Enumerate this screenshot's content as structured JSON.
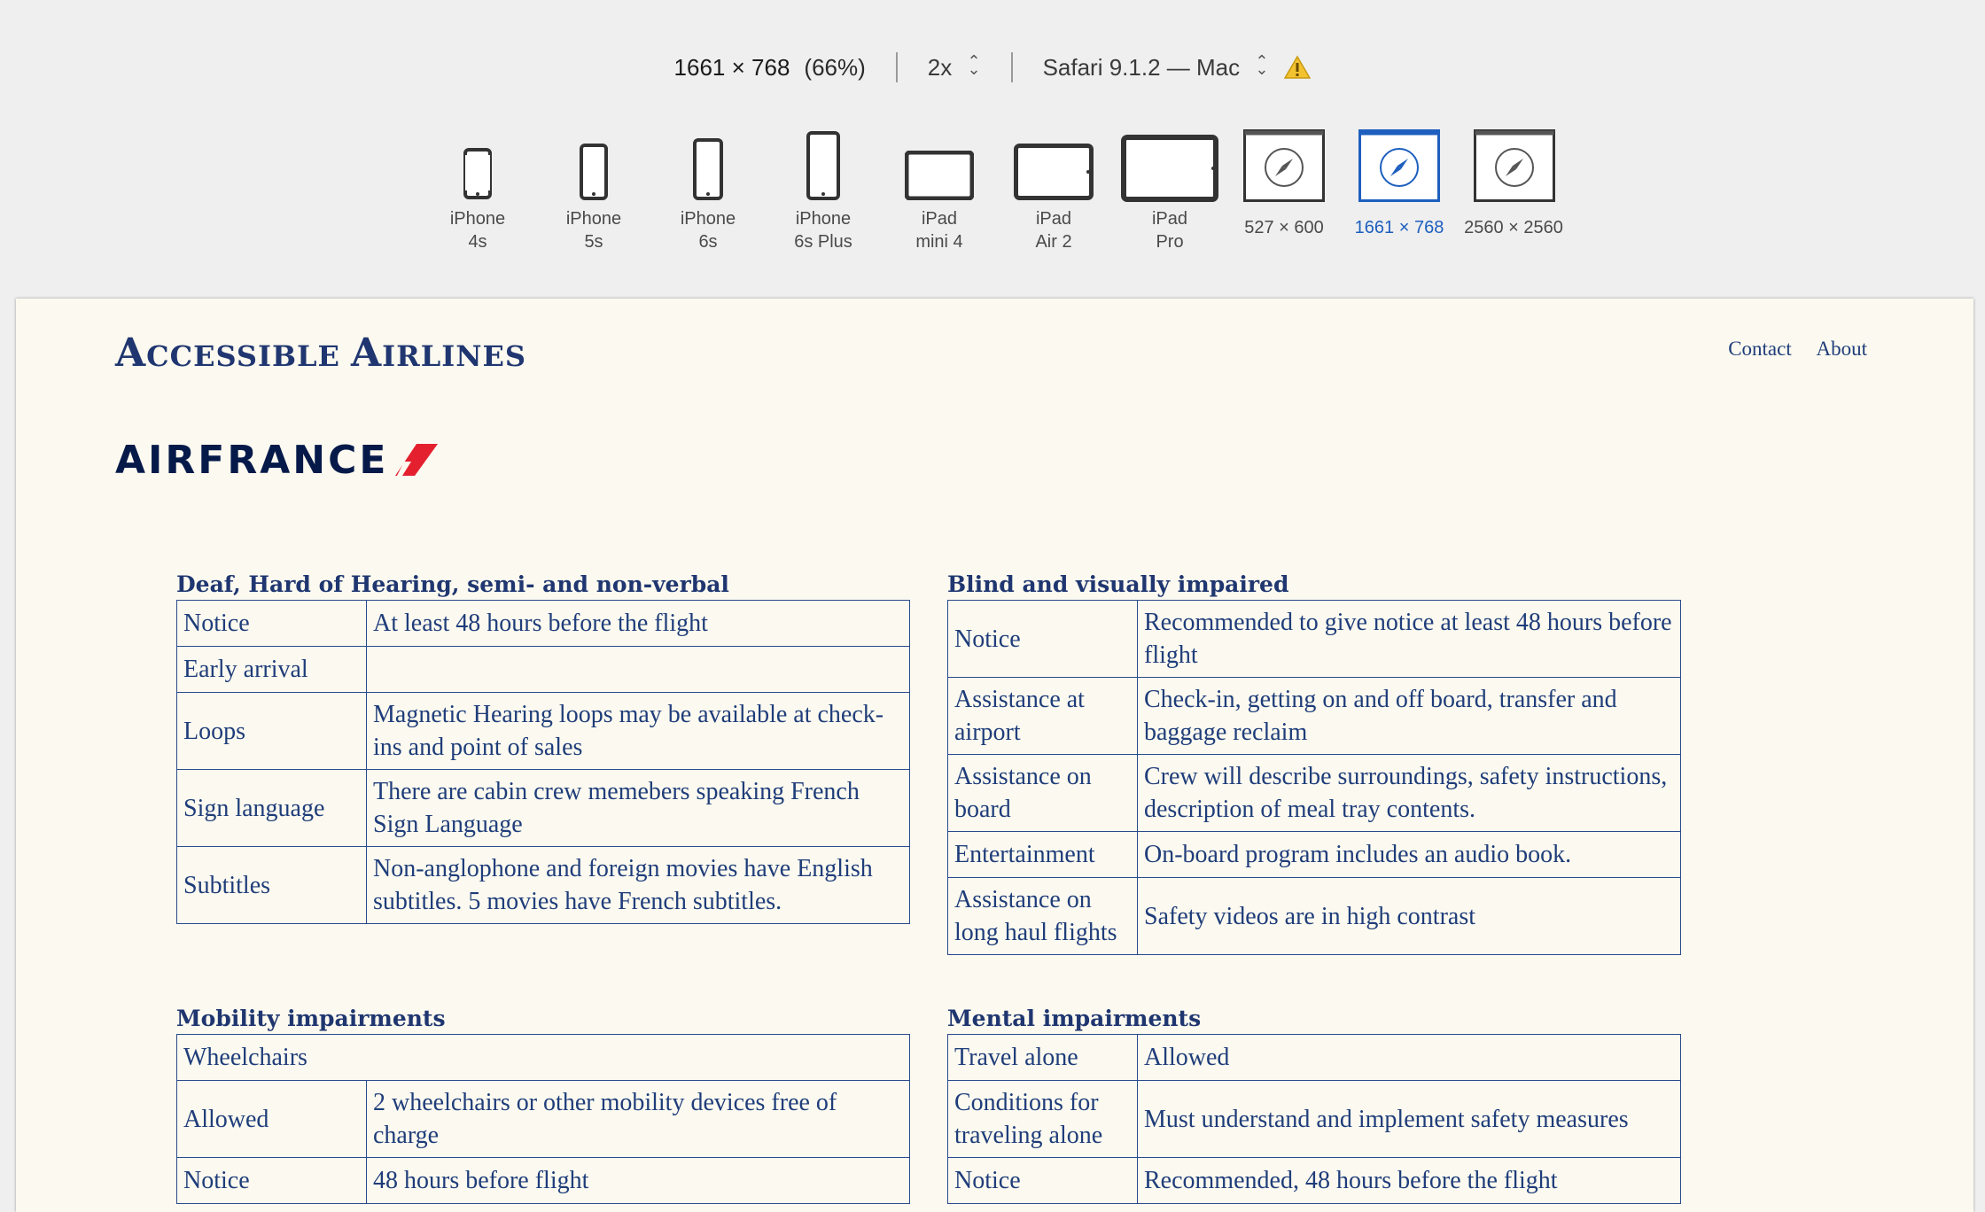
{
  "toolbar": {
    "dimensions": "1661 × 768",
    "zoom": "(66%)",
    "scale": "2x",
    "browser": "Safari 9.1.2 — Mac",
    "devices": [
      {
        "line1": "iPhone",
        "line2": "4s"
      },
      {
        "line1": "iPhone",
        "line2": "5s"
      },
      {
        "line1": "iPhone",
        "line2": "6s"
      },
      {
        "line1": "iPhone",
        "line2": "6s Plus"
      },
      {
        "line1": "iPad",
        "line2": "mini 4"
      },
      {
        "line1": "iPad",
        "line2": "Air 2"
      },
      {
        "line1": "iPad",
        "line2": "Pro"
      },
      {
        "line1": "527 × 600",
        "line2": ""
      },
      {
        "line1": "1661 × 768",
        "line2": ""
      },
      {
        "line1": "2560 × 2560",
        "line2": ""
      }
    ],
    "selected_device": "1661 × 768"
  },
  "page": {
    "site_title_first": "A",
    "site_title_rest1": "CCESSIBLE ",
    "site_title_second": "A",
    "site_title_rest2": "IRLINES",
    "nav": {
      "contact": "Contact",
      "about": "About"
    },
    "brand": "AIRFRANCE",
    "accent_red": "#e4202f",
    "navy": "#1f3670"
  },
  "sections": {
    "deaf": {
      "heading": "Deaf, Hard of Hearing, semi- and non-verbal",
      "rows": [
        {
          "key": "Notice",
          "value": "At least 48 hours before the flight"
        },
        {
          "key": "Early arrival",
          "value": ""
        },
        {
          "key": "Loops",
          "value": "Magnetic Hearing loops may be available at check-ins and point of sales"
        },
        {
          "key": "Sign language",
          "value": "There are cabin crew memebers speaking French Sign Language"
        },
        {
          "key": "Subtitles",
          "value": "Non-anglophone and foreign movies have English subtitles. 5 movies have French subtitles."
        }
      ]
    },
    "blind": {
      "heading": "Blind and visually impaired",
      "rows": [
        {
          "key": "Notice",
          "value": "Recommended to give notice at least 48 hours before flight"
        },
        {
          "key": "Assistance at airport",
          "value": "Check-in, getting on and off board, transfer and baggage reclaim"
        },
        {
          "key": "Assistance on board",
          "value": "Crew will describe surroundings, safety instructions, description of meal tray contents."
        },
        {
          "key": "Entertainment",
          "value": "On-board program includes an audio book."
        },
        {
          "key": "Assistance on long haul flights",
          "value": "Safety videos are in high contrast"
        }
      ]
    },
    "mobility": {
      "heading": "Mobility impairments",
      "full_row": "Wheelchairs",
      "rows": [
        {
          "key": "Allowed",
          "value": "2 wheelchairs or other mobility devices free of charge"
        },
        {
          "key": "Notice",
          "value": "48 hours before flight"
        }
      ]
    },
    "mental": {
      "heading": "Mental impairments",
      "rows": [
        {
          "key": "Travel alone",
          "value": "Allowed"
        },
        {
          "key": "Conditions for traveling alone",
          "value": "Must understand and implement safety measures"
        },
        {
          "key": "Notice",
          "value": "Recommended, 48 hours before the flight"
        }
      ]
    }
  }
}
